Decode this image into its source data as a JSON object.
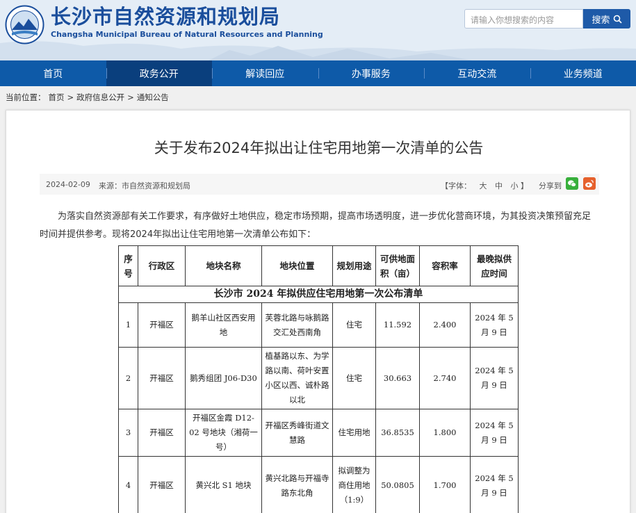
{
  "header": {
    "title_cn": "长沙市自然资源和规划局",
    "title_en": "Changsha Municipal Bureau of Natural Resources and Planning",
    "search_placeholder": "请输入你想搜索的内容",
    "search_label": "搜索",
    "logo_icon": "bureau-seal-logo"
  },
  "nav": {
    "items": [
      "首页",
      "政务公开",
      "解读回应",
      "办事服务",
      "互动交流",
      "业务频道"
    ],
    "active_index": 1
  },
  "breadcrumb": {
    "prefix": "当前位置：",
    "items": [
      "首页",
      "政府信息公开",
      "通知公告"
    ],
    "separator": ">"
  },
  "article": {
    "title": "关于发布2024年拟出让住宅用地第一次清单的公告",
    "date": "2024-02-09",
    "source": "来源：市自然资源和规划局",
    "font_label": "【字体：",
    "font_sizes": [
      "大",
      "中",
      "小"
    ],
    "font_end": "】",
    "share_label": "分享到",
    "intro": "为落实自然资源部有关工作要求，有序做好土地供应，稳定市场预期，提高市场透明度，进一步优化营商环境，为其投资决策预留充足时间并提供参考。现将2024年拟出让住宅用地第一次清单公布如下："
  },
  "table": {
    "caption": "长沙市 2024 年拟供应住宅用地第一次公布清单",
    "headers": [
      "序号",
      "行政区",
      "地块名称",
      "地块位置",
      "规划用途",
      "可供地面积（亩）",
      "容积率",
      "最晚拟供应时间"
    ],
    "rows": [
      [
        "1",
        "开福区",
        "鹅羊山社区西安用地",
        "芙蓉北路与咏鹅路交汇处西南角",
        "住宅",
        "11.592",
        "2.400",
        "2024 年 5 月 9 日"
      ],
      [
        "2",
        "开福区",
        "鹅秀组团 J06-D30",
        "植基路以东、为学路以南、荷叶安置小区以西、诚朴路以北",
        "住宅",
        "30.663",
        "2.740",
        "2024 年 5 月 9 日"
      ],
      [
        "3",
        "开福区",
        "开福区金霞 D12-02 号地块（湘荷一号）",
        "开福区秀峰街道文慧路",
        "住宅用地",
        "36.8535",
        "1.800",
        "2024 年 5 月 9 日"
      ],
      [
        "4",
        "开福区",
        "黄兴北 S1 地块",
        "黄兴北路与开福寺路东北角",
        "拟调整为商住用地（1:9）",
        "50.0805",
        "1.700",
        "2024 年 5 月 9 日"
      ]
    ]
  },
  "colors": {
    "brand_blue": "#1a4e9c",
    "nav_bg": "#0e5aa8",
    "nav_active": "#0a3f7d",
    "wechat_green": "#38b03c",
    "weibo_orange": "#e6612d"
  }
}
